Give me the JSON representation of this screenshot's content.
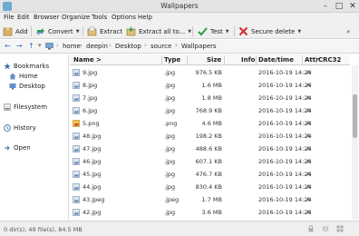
{
  "window": {
    "title": "Wallpapers"
  },
  "menu": [
    "File",
    "Edit",
    "Browser",
    "Organize",
    "Tools",
    "Options",
    "Help"
  ],
  "toolbar": {
    "add": "Add",
    "convert": "Convert",
    "extract": "Extract",
    "extract_all": "Extract all to...",
    "test": "Test",
    "secure_delete": "Secure delete"
  },
  "breadcrumb": [
    "home",
    "deepin",
    "Desktop",
    "source",
    "Wallpapers"
  ],
  "sidebar": {
    "bookmarks": "Bookmarks",
    "home": "Home",
    "desktop": "Desktop",
    "filesystem": "Filesystem",
    "history": "History",
    "open": "Open"
  },
  "columns": {
    "name": "Name >",
    "type": "Type",
    "size": "Size",
    "info": "Info",
    "datetime": "Date/time",
    "attr": "Attr",
    "crc": "CRC32"
  },
  "files": [
    {
      "name": "9.jpg",
      "type": ".jpg",
      "size": "976.5 KB",
      "date": "2016-10-19 14:24",
      "attr": "A",
      "kind": "image"
    },
    {
      "name": "8.jpg",
      "type": ".jpg",
      "size": "1.6 MB",
      "date": "2016-10-19 14:24",
      "attr": "A",
      "kind": "image"
    },
    {
      "name": "7.jpg",
      "type": ".jpg",
      "size": "1.8 MB",
      "date": "2016-10-19 14:24",
      "attr": "A",
      "kind": "image"
    },
    {
      "name": "6.jpg",
      "type": ".jpg",
      "size": "768.9 KB",
      "date": "2016-10-19 14:24",
      "attr": "A",
      "kind": "image"
    },
    {
      "name": "5.png",
      "type": ".png",
      "size": "4.6 MB",
      "date": "2016-10-19 14:24",
      "attr": "A",
      "kind": "png"
    },
    {
      "name": "48.jpg",
      "type": ".jpg",
      "size": "198.2 KB",
      "date": "2016-10-19 14:24",
      "attr": "A",
      "kind": "image"
    },
    {
      "name": "47.jpg",
      "type": ".jpg",
      "size": "488.6 KB",
      "date": "2016-10-19 14:24",
      "attr": "A",
      "kind": "image"
    },
    {
      "name": "46.jpg",
      "type": ".jpg",
      "size": "607.1 KB",
      "date": "2016-10-19 14:24",
      "attr": "A",
      "kind": "image"
    },
    {
      "name": "45.jpg",
      "type": ".jpg",
      "size": "476.7 KB",
      "date": "2016-10-19 14:24",
      "attr": "A",
      "kind": "image"
    },
    {
      "name": "44.jpg",
      "type": ".jpg",
      "size": "830.4 KB",
      "date": "2016-10-19 14:24",
      "attr": "A",
      "kind": "image"
    },
    {
      "name": "43.jpeg",
      "type": ".jpeg",
      "size": "1.7 MB",
      "date": "2016-10-19 14:24",
      "attr": "A",
      "kind": "image"
    },
    {
      "name": "42.jpg",
      "type": ".jpg",
      "size": "3.6 MB",
      "date": "2016-10-19 14:24",
      "attr": "A",
      "kind": "image"
    }
  ],
  "status": {
    "text": "0 dir(s), 49 file(s), 84.5 MB"
  },
  "colors": {
    "accent": "#3a6fb0",
    "convert_icon": "#2f9a4a",
    "test_icon": "#2e9a3a",
    "delete_icon": "#d22b2b"
  }
}
